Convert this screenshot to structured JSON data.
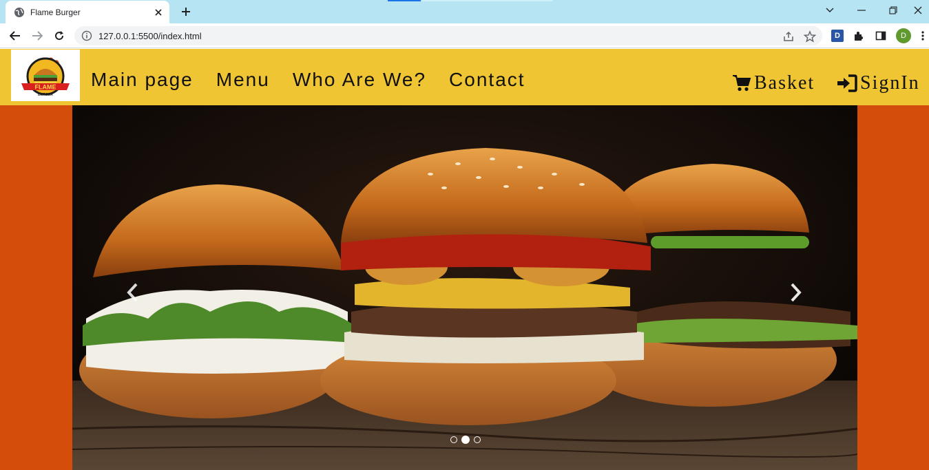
{
  "browser": {
    "tab_title": "Flame Burger",
    "url": "127.0.0.1:5500/index.html",
    "extension_label": "D",
    "profile_initial": "D"
  },
  "site": {
    "logo_text": "FLAME",
    "logo_subtext": "BURGER",
    "nav": {
      "main_page": "Main page",
      "menu": "Menu",
      "who_are_we": "Who Are We?",
      "contact": "Contact"
    },
    "basket_label": "Basket",
    "signin_label": "SignIn"
  },
  "carousel": {
    "slide_count": 3,
    "active_slide": 2
  },
  "colors": {
    "header_bg": "#efc534",
    "hero_bg": "#d44d0b",
    "tabstrip_bg": "#b7e4f2"
  }
}
